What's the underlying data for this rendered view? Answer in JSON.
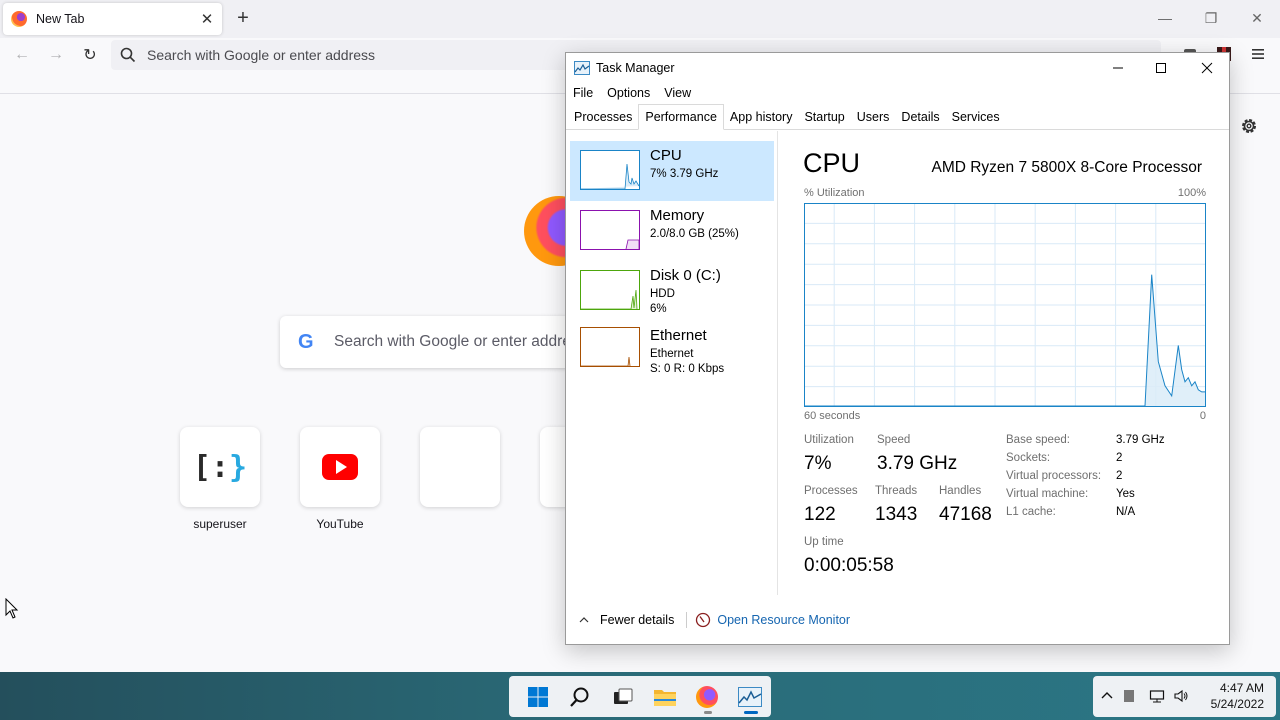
{
  "browser": {
    "tab_title": "New Tab",
    "url_placeholder": "Search with Google or enter address",
    "search_placeholder": "Search with Google or enter address",
    "shortcuts": [
      {
        "label": "superuser",
        "icon": "superuser-logo-icon"
      },
      {
        "label": "YouTube",
        "icon": "youtube-logo-icon"
      },
      {
        "label": "",
        "icon": "empty-tile"
      },
      {
        "label": "",
        "icon": "empty-tile"
      }
    ]
  },
  "task_manager": {
    "title": "Task Manager",
    "menu": [
      "File",
      "Options",
      "View"
    ],
    "tabs": [
      "Processes",
      "Performance",
      "App history",
      "Startup",
      "Users",
      "Details",
      "Services"
    ],
    "active_tab": "Performance",
    "resources": [
      {
        "name": "CPU",
        "line1": "7% 3.79 GHz",
        "line2": "",
        "color": "#1a84c7"
      },
      {
        "name": "Memory",
        "line1": "2.0/8.0 GB (25%)",
        "line2": "",
        "color": "#8b12ae"
      },
      {
        "name": "Disk 0 (C:)",
        "line1": "HDD",
        "line2": "6%",
        "color": "#4da60c"
      },
      {
        "name": "Ethernet",
        "line1": "Ethernet",
        "line2": "S: 0 R: 0 Kbps",
        "color": "#a74f01"
      }
    ],
    "cpu": {
      "heading": "CPU",
      "model": "AMD Ryzen 7 5800X 8-Core Processor",
      "util_label": "% Utilization",
      "max_label": "100%",
      "time_label": "60 seconds",
      "zero_label": "0",
      "utilization_label": "Utilization",
      "utilization": "7%",
      "speed_label": "Speed",
      "speed": "3.79 GHz",
      "processes_label": "Processes",
      "processes": "122",
      "threads_label": "Threads",
      "threads": "1343",
      "handles_label": "Handles",
      "handles": "47168",
      "uptime_label": "Up time",
      "uptime": "0:00:05:58",
      "details": [
        {
          "k": "Base speed:",
          "v": "3.79 GHz"
        },
        {
          "k": "Sockets:",
          "v": "2"
        },
        {
          "k": "Virtual processors:",
          "v": "2"
        },
        {
          "k": "Virtual machine:",
          "v": "Yes"
        },
        {
          "k": "L1 cache:",
          "v": "N/A"
        }
      ]
    },
    "footer": {
      "fewer_details": "Fewer details",
      "open_monitor": "Open Resource Monitor"
    }
  },
  "chart_data": {
    "type": "area",
    "title": "CPU",
    "ylabel": "% Utilization",
    "ylim": [
      0,
      100
    ],
    "xlim": [
      60,
      0
    ],
    "x_label_left": "60 seconds",
    "x_label_right": "0",
    "grid": true,
    "series": [
      {
        "color": "#1a84c7",
        "x": [
          60,
          57,
          54,
          51,
          48,
          45,
          42,
          39,
          36,
          33,
          30,
          27,
          24,
          21,
          18,
          15,
          12,
          9,
          8,
          7,
          6,
          5,
          4,
          3.5,
          3,
          2.5,
          2,
          1.5,
          1,
          0.5,
          0
        ],
        "values": [
          0,
          0,
          0,
          0,
          0,
          0,
          0,
          0,
          0,
          0,
          0,
          0,
          0,
          0,
          0,
          0,
          0,
          0,
          65,
          22,
          10,
          5,
          30,
          18,
          12,
          14,
          10,
          12,
          8,
          7,
          7
        ]
      }
    ]
  },
  "taskbar": {
    "apps": [
      "start-icon",
      "search-icon",
      "task-view-icon",
      "file-explorer-icon",
      "firefox-icon",
      "task-manager-icon"
    ],
    "time": "4:47 AM",
    "date": "5/24/2022",
    "accent": "#0067c0"
  }
}
